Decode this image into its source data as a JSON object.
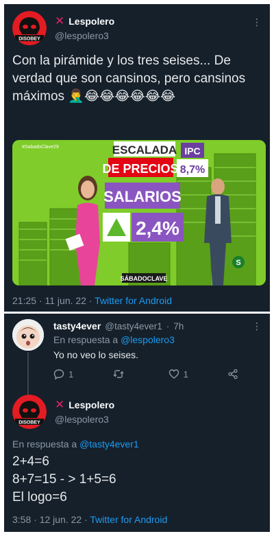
{
  "tweet1": {
    "name": "Lespolero",
    "handle": "@lespolero3",
    "avatar_text": "DISOBEY",
    "text": "Con la pirámide y los tres seises... De verdad que son cansinos, pero cansinos máximos 🤦‍♂️😂😂😂😂😂😂",
    "media": {
      "tag": "#SabadoClave29",
      "headline_top": "ESCALADA",
      "headline_bottom": "DE PRECIOS",
      "ipc_label": "IPC",
      "ipc_value": "8,7%",
      "salary_label": "SALARIOS",
      "salary_value": "2,4%",
      "show_logo": "SÁBADOCLAVE",
      "channel_logo": "S"
    },
    "time": "21:25",
    "date": "11 jun. 22",
    "source": "Twitter for Android"
  },
  "reply1": {
    "name": "tasty4ever",
    "handle": "@tasty4ever1",
    "age": "7h",
    "reply_prefix": "En respuesta a",
    "reply_target": "@lespolero3",
    "text": "Yo no veo lo seises.",
    "reply_count": "1",
    "retweet_count": "",
    "like_count": "1"
  },
  "tweet2": {
    "name": "Lespolero",
    "handle": "@lespolero3",
    "avatar_text": "DISOBEY",
    "reply_prefix": "En respuesta a",
    "reply_target": "@tasty4ever1",
    "lines": [
      "2+4=6",
      "8+7=15 - > 1+5=6",
      "El logo=6"
    ],
    "time": "3:58",
    "date": "12 jun. 22",
    "source": "Twitter for Android"
  },
  "separator": "·",
  "colors": {
    "background": "#15202b",
    "link": "#1d9bf0",
    "muted": "#8b98a5",
    "text": "#e7e9ea",
    "x_mark": "#e0245e",
    "media_green": "#7fcc2a"
  }
}
